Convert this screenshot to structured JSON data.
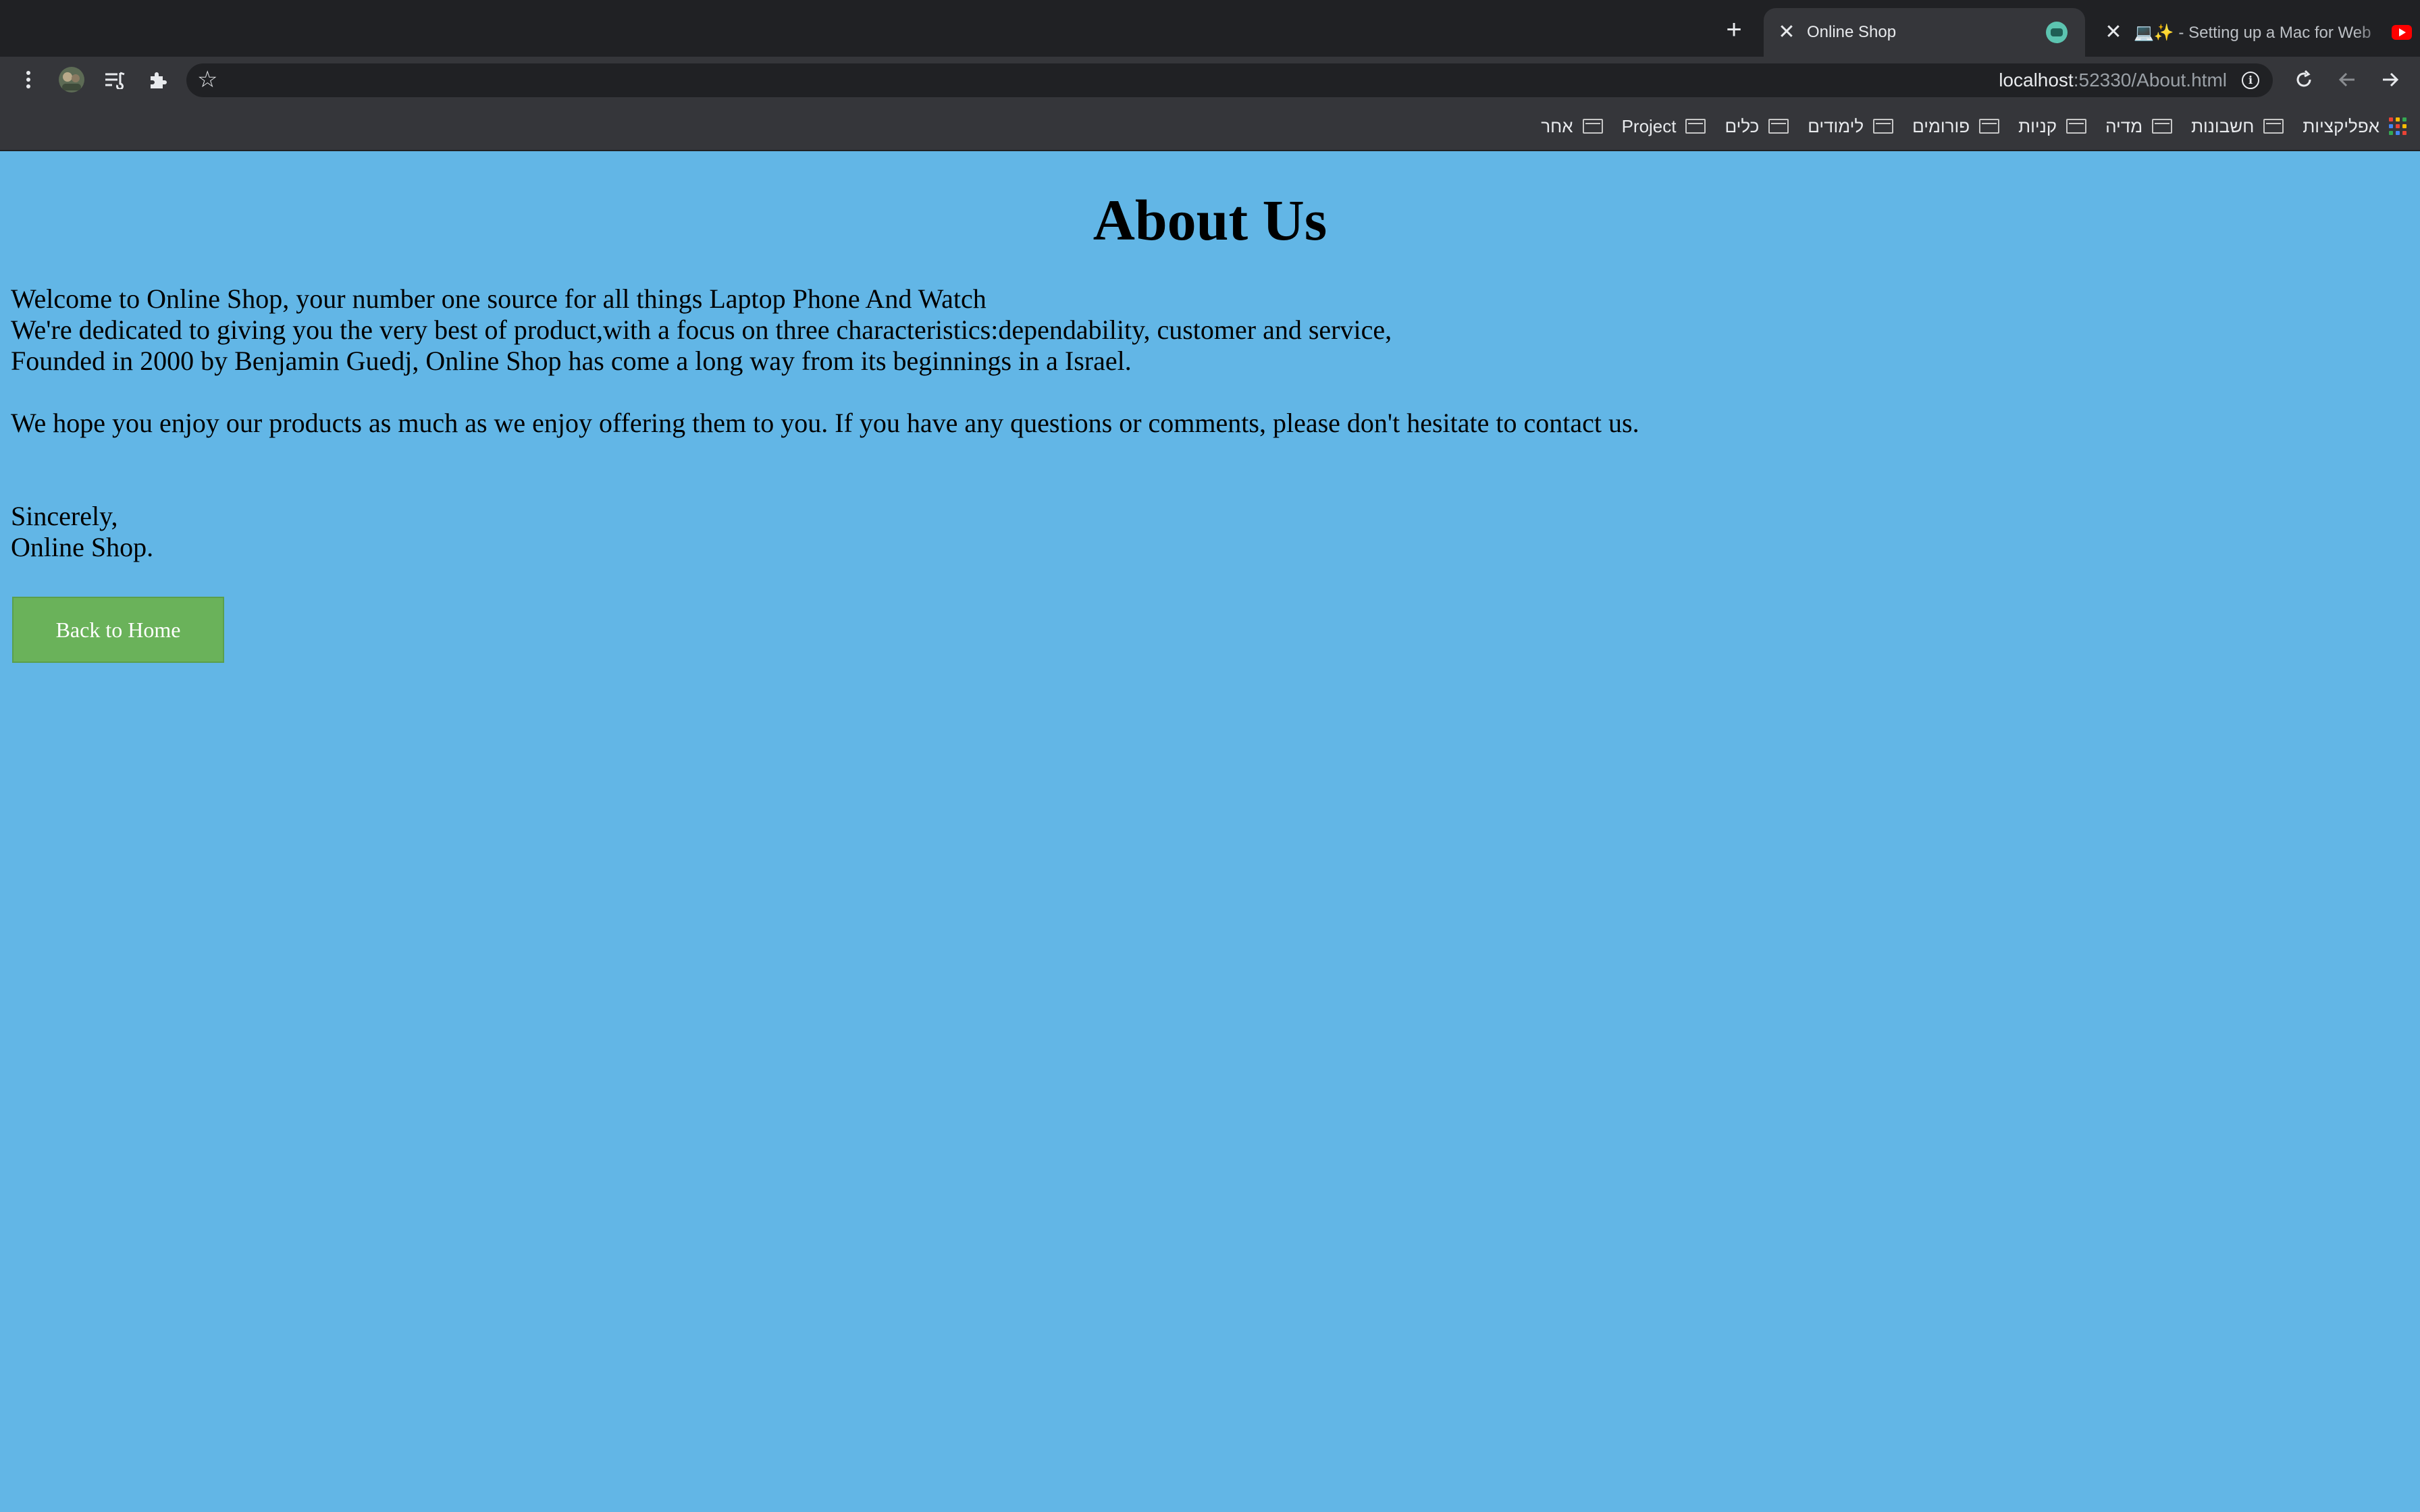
{
  "browser": {
    "tabs": [
      {
        "title": "Online Shop",
        "active": true,
        "close": "✕"
      },
      {
        "title": "💻✨ - Setting up a Mac for Web",
        "active": false,
        "close": "✕"
      }
    ],
    "new_tab": "+",
    "address": {
      "host": "localhost",
      "rest": ":52330/About.html"
    },
    "icons": {
      "menu": "kebab-icon",
      "profile": "avatar",
      "reading_list": "reading-list-icon",
      "extensions": "puzzle-icon",
      "bookmark": "star-icon",
      "site_info": "info-icon",
      "reload": "reload-icon",
      "back": "back-arrow-icon",
      "forward": "forward-arrow-icon"
    },
    "bookmarks": [
      {
        "label": "אפליקציות",
        "icon": "apps-grid-icon"
      },
      {
        "label": "חשבונות",
        "icon": "folder-icon"
      },
      {
        "label": "מדיה",
        "icon": "folder-icon"
      },
      {
        "label": "קניות",
        "icon": "folder-icon"
      },
      {
        "label": "פורומים",
        "icon": "folder-icon"
      },
      {
        "label": "לימודים",
        "icon": "folder-icon"
      },
      {
        "label": "כלים",
        "icon": "folder-icon"
      },
      {
        "label": "Project",
        "icon": "folder-icon"
      },
      {
        "label": "אחר",
        "icon": "folder-icon"
      }
    ],
    "colors": {
      "tab_strip": "#202124",
      "toolbar": "#35363a"
    }
  },
  "page": {
    "title": "About Us",
    "intro_lines": [
      "Welcome to Online Shop, your number one source for all things Laptop Phone And Watch",
      "We're dedicated to giving you the very best of product,with a focus on three characteristics:dependability, customer and service,",
      "Founded in 2000 by Benjamin Guedj, Online Shop has come a long way from its beginnings in a Israel."
    ],
    "hope_text": "We hope you enjoy our products as much as we enjoy offering them to you. If you have any questions or comments, please don't hesitate to contact us.",
    "closing_lines": [
      "Sincerely,",
      "Online Shop."
    ],
    "back_button": "Back to Home",
    "colors": {
      "background": "#62b6e6",
      "button": "#6ab25a"
    }
  }
}
